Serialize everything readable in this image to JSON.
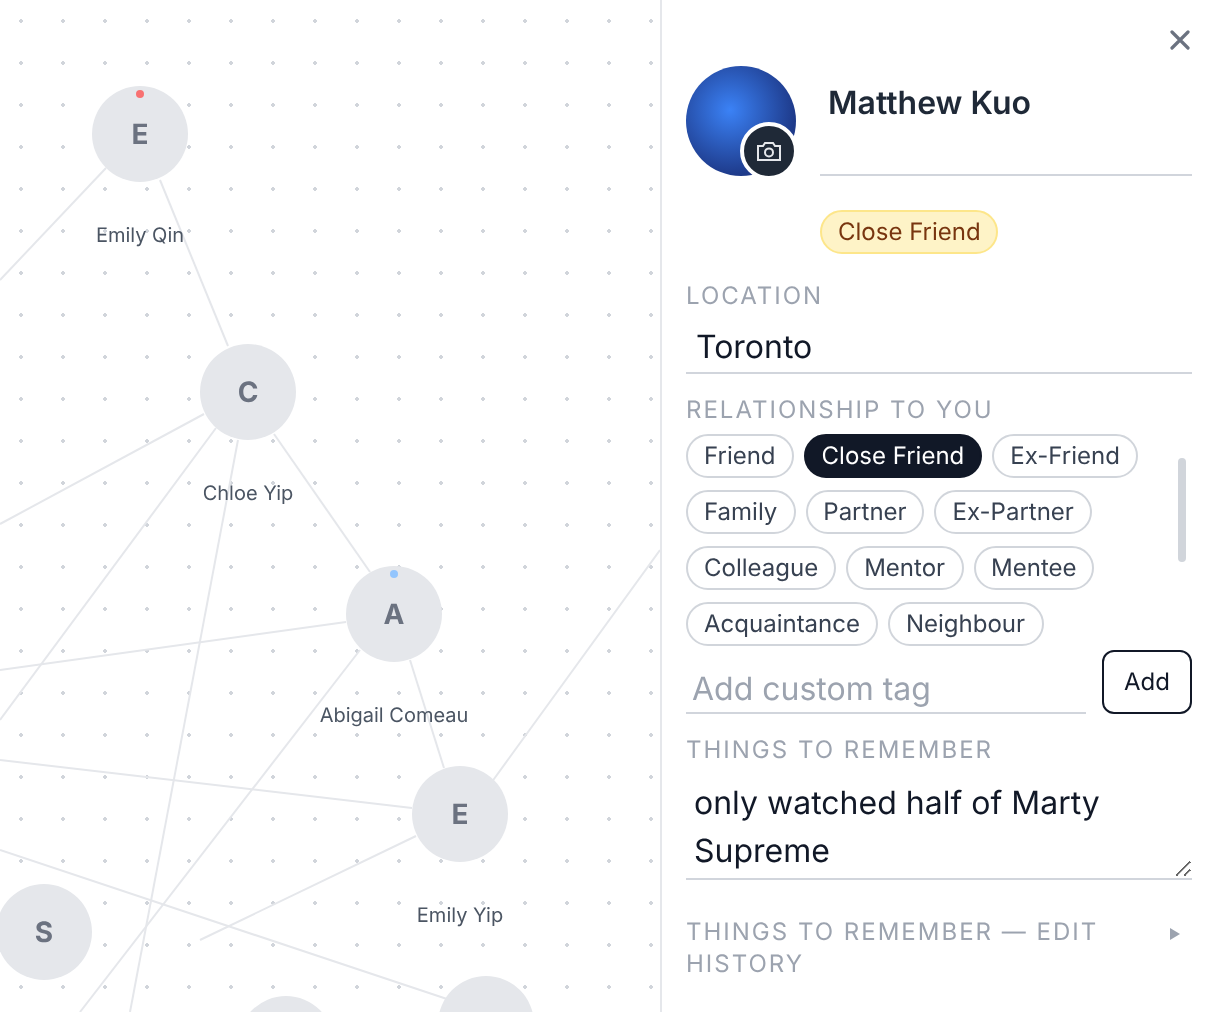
{
  "graph": {
    "nodes": [
      {
        "initial": "E",
        "name": "Emily Qin",
        "color": "#f87171"
      },
      {
        "initial": "C",
        "name": "Chloe Yip"
      },
      {
        "initial": "A",
        "name": "Abigail Comeau",
        "color": "#93c5fd"
      },
      {
        "initial": "E",
        "name": "Emily Yip"
      },
      {
        "initial": "S"
      }
    ]
  },
  "panel": {
    "name": "Matthew Kuo",
    "badge": "Close Friend",
    "location": {
      "label": "LOCATION",
      "value": "Toronto"
    },
    "relationship": {
      "label": "RELATIONSHIP TO YOU",
      "tags": [
        {
          "label": "Friend",
          "selected": false
        },
        {
          "label": "Close Friend",
          "selected": true
        },
        {
          "label": "Ex-Friend",
          "selected": false
        },
        {
          "label": "Family",
          "selected": false
        },
        {
          "label": "Partner",
          "selected": false
        },
        {
          "label": "Ex-Partner",
          "selected": false
        },
        {
          "label": "Colleague",
          "selected": false
        },
        {
          "label": "Mentor",
          "selected": false
        },
        {
          "label": "Mentee",
          "selected": false
        },
        {
          "label": "Acquaintance",
          "selected": false
        },
        {
          "label": "Neighbour",
          "selected": false
        }
      ],
      "custom_tag": {
        "placeholder": "Add custom tag"
      },
      "add_button": "Add"
    },
    "remember": {
      "label": "THINGS TO REMEMBER",
      "value": "only watched half of Marty Supreme"
    },
    "history": {
      "label": "THINGS TO REMEMBER — EDIT HISTORY",
      "expanded": false
    }
  }
}
